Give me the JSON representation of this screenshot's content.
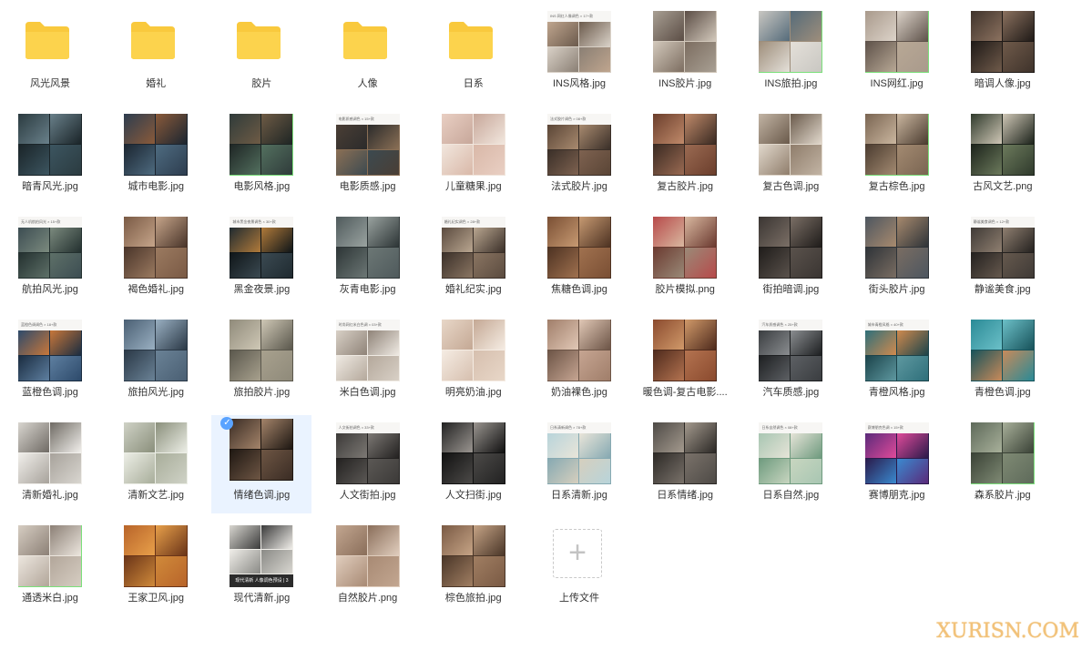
{
  "items": [
    {
      "label": "风光风景",
      "type": "folder"
    },
    {
      "label": "婚礼",
      "type": "folder"
    },
    {
      "label": "胶片",
      "type": "folder"
    },
    {
      "label": "人像",
      "type": "folder"
    },
    {
      "label": "日系",
      "type": "folder"
    },
    {
      "label": "INS风格.jpg",
      "type": "image",
      "colors": [
        "#bfa58e",
        "#6b5a4c",
        "#d9d1c7",
        "#8a7f74"
      ],
      "header": "INS 网红人像调色 × 17+款"
    },
    {
      "label": "INS胶片.jpg",
      "type": "image",
      "colors": [
        "#a89f93",
        "#5b4d45",
        "#d2c8bb",
        "#7c6d60"
      ]
    },
    {
      "label": "INS旅拍.jpg",
      "type": "image",
      "colors": [
        "#c9c7c2",
        "#556b7a",
        "#9e8e7b",
        "#e4e0d9"
      ],
      "green": true
    },
    {
      "label": "INS网红.jpg",
      "type": "image",
      "colors": [
        "#a99a8c",
        "#dcd3c9",
        "#5e524a",
        "#b8a895"
      ],
      "green": true
    },
    {
      "label": "暗调人像.jpg",
      "type": "image",
      "colors": [
        "#3f332b",
        "#8b715f",
        "#1f1a17",
        "#6f5a4a"
      ]
    },
    {
      "label": "暗青风光.jpg",
      "type": "image",
      "colors": [
        "#2b3b40",
        "#69808a",
        "#1a2428",
        "#3c5560"
      ]
    },
    {
      "label": "城市电影.jpg",
      "type": "image",
      "colors": [
        "#2d3d4f",
        "#8a5a3a",
        "#1b2530",
        "#4e6b80"
      ]
    },
    {
      "label": "电影风格.jpg",
      "type": "image",
      "colors": [
        "#2f3b3a",
        "#6e5b45",
        "#1e2524",
        "#53705f"
      ],
      "green": true
    },
    {
      "label": "电影质感.jpg",
      "type": "image",
      "colors": [
        "#4a3e35",
        "#2b2b2b",
        "#8a6f55",
        "#3c4a50"
      ],
      "header": "电影质感调色 × 15+款"
    },
    {
      "label": "儿童糖果.jpg",
      "type": "image",
      "colors": [
        "#e9cfc3",
        "#c7a79a",
        "#f1e6dd",
        "#d9b8a8"
      ]
    },
    {
      "label": "法式胶片.jpg",
      "type": "image",
      "colors": [
        "#5a4536",
        "#a88a6f",
        "#3a2f28",
        "#7e6250"
      ],
      "header": "法式胶片调色 × 08+款"
    },
    {
      "label": "复古胶片.jpg",
      "type": "image",
      "colors": [
        "#6b3e2c",
        "#c08a6a",
        "#3a2a22",
        "#9a6a52"
      ]
    },
    {
      "label": "复古色调.jpg",
      "type": "image",
      "colors": [
        "#c2b4a4",
        "#6a5a4b",
        "#e1d8cc",
        "#8f7d6b"
      ]
    },
    {
      "label": "复古棕色.jpg",
      "type": "image",
      "colors": [
        "#7a6552",
        "#cab69f",
        "#4b3c30",
        "#a38a71"
      ],
      "green": true
    },
    {
      "label": "古风文艺.png",
      "type": "image",
      "colors": [
        "#2f3a2c",
        "#cfc7b6",
        "#1c231b",
        "#6c7a5c"
      ]
    },
    {
      "label": "航拍风光.jpg",
      "type": "image",
      "colors": [
        "#3c4d52",
        "#7b8a7e",
        "#23302f",
        "#5e7068"
      ],
      "header": "无人机航拍风光 × 15+款"
    },
    {
      "label": "褐色婚礼.jpg",
      "type": "image",
      "colors": [
        "#7a5a45",
        "#c6a58a",
        "#4a352a",
        "#9b7a60"
      ]
    },
    {
      "label": "黑金夜景.jpg",
      "type": "image",
      "colors": [
        "#1f2a30",
        "#b07a3a",
        "#0f1518",
        "#3b4a52"
      ],
      "header": "城市黑金夜景调色 × 30+款"
    },
    {
      "label": "灰青电影.jpg",
      "type": "image",
      "colors": [
        "#4f5a5c",
        "#9aa3a0",
        "#2d3536",
        "#6c7775"
      ]
    },
    {
      "label": "婚礼纪实.jpg",
      "type": "image",
      "colors": [
        "#5b4b3f",
        "#b9a690",
        "#3b3029",
        "#8a7562"
      ],
      "header": "婚礼纪实调色 × 28+款"
    },
    {
      "label": "焦糖色调.jpg",
      "type": "image",
      "colors": [
        "#7a4f34",
        "#c79a72",
        "#4d3222",
        "#a0714f"
      ]
    },
    {
      "label": "胶片模拟.png",
      "type": "image",
      "colors": [
        "#b74a4a",
        "#d9b8a0",
        "#6b3a30",
        "#9a8a78"
      ]
    },
    {
      "label": "街拍暗调.jpg",
      "type": "image",
      "colors": [
        "#3a3532",
        "#7b6f66",
        "#1f1c1a",
        "#5a524c"
      ]
    },
    {
      "label": "街头胶片.jpg",
      "type": "image",
      "colors": [
        "#4d5660",
        "#a88a6e",
        "#2e3338",
        "#7a6d62"
      ]
    },
    {
      "label": "静谧美食.jpg",
      "type": "image",
      "colors": [
        "#3f3a36",
        "#8f7f70",
        "#24211f",
        "#66594e"
      ],
      "header": "静谧美食调色 × 12+款"
    },
    {
      "label": "蓝橙色调.jpg",
      "type": "image",
      "colors": [
        "#2d4a6b",
        "#c8773a",
        "#1a2c40",
        "#5e7fa0"
      ],
      "header": "蓝橙色调调色 × 18+款"
    },
    {
      "label": "旅拍风光.jpg",
      "type": "image",
      "colors": [
        "#4a5f73",
        "#9ab0c2",
        "#2a3846",
        "#6a8296"
      ]
    },
    {
      "label": "旅拍胶片.jpg",
      "type": "image",
      "colors": [
        "#8f8a7a",
        "#cfc8b6",
        "#5a574c",
        "#a8a18e"
      ]
    },
    {
      "label": "米白色调.jpg",
      "type": "image",
      "colors": [
        "#d8d0c6",
        "#8f8378",
        "#efeae3",
        "#b4a89b"
      ],
      "header": "时尚网红米白色调 × 03+款"
    },
    {
      "label": "明亮奶油.jpg",
      "type": "image",
      "colors": [
        "#e8d7c8",
        "#c4a894",
        "#f5ece3",
        "#d6bfae"
      ]
    },
    {
      "label": "奶油裸色.jpg",
      "type": "image",
      "colors": [
        "#a07e6a",
        "#e1c8b6",
        "#6c5446",
        "#c6a592"
      ]
    },
    {
      "label": "暖色调-复古电影....",
      "type": "image",
      "colors": [
        "#8a4a2e",
        "#d19a6a",
        "#4e2a1c",
        "#b47350"
      ]
    },
    {
      "label": "汽车质感.jpg",
      "type": "image",
      "colors": [
        "#3a3d40",
        "#8a8d90",
        "#1d1f21",
        "#5d6064"
      ],
      "header": "汽车质感调色 × 25+款"
    },
    {
      "label": "青橙风格.jpg",
      "type": "image",
      "colors": [
        "#2e6f7a",
        "#d08a4e",
        "#1b434a",
        "#5e98a0"
      ],
      "header": "城市青橙风格 × 40+款"
    },
    {
      "label": "青橙色调.jpg",
      "type": "image",
      "colors": [
        "#2a8a96",
        "#6cc0c8",
        "#17525a",
        "#c88a5a"
      ]
    },
    {
      "label": "清新婚礼.jpg",
      "type": "image",
      "colors": [
        "#d9d6d0",
        "#6f6a64",
        "#f1efeb",
        "#a7a29b"
      ]
    },
    {
      "label": "清新文艺.jpg",
      "type": "image",
      "colors": [
        "#cfd2c6",
        "#8a8f7b",
        "#eceee6",
        "#a8ad9a"
      ]
    },
    {
      "label": "情绪色调.jpg",
      "type": "image",
      "colors": [
        "#3a2c24",
        "#a4846a",
        "#1e1712",
        "#6e5644"
      ],
      "selected": true
    },
    {
      "label": "人文街拍.jpg",
      "type": "image",
      "colors": [
        "#3c3a38",
        "#7c7874",
        "#232120",
        "#5b5855"
      ],
      "header": "人文街拍调色 × 33+款"
    },
    {
      "label": "人文扫街.jpg",
      "type": "image",
      "colors": [
        "#222222",
        "#9a9590",
        "#111111",
        "#4c4a48"
      ]
    },
    {
      "label": "日系清新.jpg",
      "type": "image",
      "colors": [
        "#b8d4da",
        "#e9e5d9",
        "#86a9b2",
        "#d6cfbe"
      ],
      "header": "日系清新调色 × 78+款"
    },
    {
      "label": "日系情绪.jpg",
      "type": "image",
      "colors": [
        "#4e4a46",
        "#a49a8e",
        "#2c2926",
        "#7a726a"
      ]
    },
    {
      "label": "日系自然.jpg",
      "type": "image",
      "colors": [
        "#a8c6b2",
        "#e6e4d8",
        "#6e9a7e",
        "#c8d6c0"
      ],
      "header": "日系自然调色 × 08+款"
    },
    {
      "label": "赛博朋克.jpg",
      "type": "image",
      "colors": [
        "#5a2a7a",
        "#e04a9a",
        "#2a1a4a",
        "#3a8ad0"
      ],
      "header": "赛博朋克色调 × 15+款"
    },
    {
      "label": "森系胶片.jpg",
      "type": "image",
      "colors": [
        "#5e6a5a",
        "#a8b09a",
        "#3a4236",
        "#7f8a74"
      ],
      "green": true
    },
    {
      "label": "通透米白.jpg",
      "type": "image",
      "colors": [
        "#d6cdc2",
        "#8c8076",
        "#ece6de",
        "#b2a69a"
      ],
      "green": true
    },
    {
      "label": "王家卫风.jpg",
      "type": "image",
      "colors": [
        "#b8642a",
        "#e8a04a",
        "#6a3418",
        "#d08a3a"
      ]
    },
    {
      "label": "现代清新.jpg",
      "type": "image",
      "colors": [
        "#d8d6d0",
        "#3a3a3a",
        "#f0eee9",
        "#8a8a86"
      ],
      "band": "现代清新 人像调色预设 | 3"
    },
    {
      "label": "自然胶片.png",
      "type": "image",
      "colors": [
        "#c2a690",
        "#8a6e5a",
        "#e0cdbd",
        "#a88a74"
      ]
    },
    {
      "label": "棕色旅拍.jpg",
      "type": "image",
      "colors": [
        "#7a5a44",
        "#c6a486",
        "#4a3628",
        "#a07e62"
      ]
    },
    {
      "label": "上传文件",
      "type": "upload"
    }
  ],
  "watermark": "XURISN.COM"
}
